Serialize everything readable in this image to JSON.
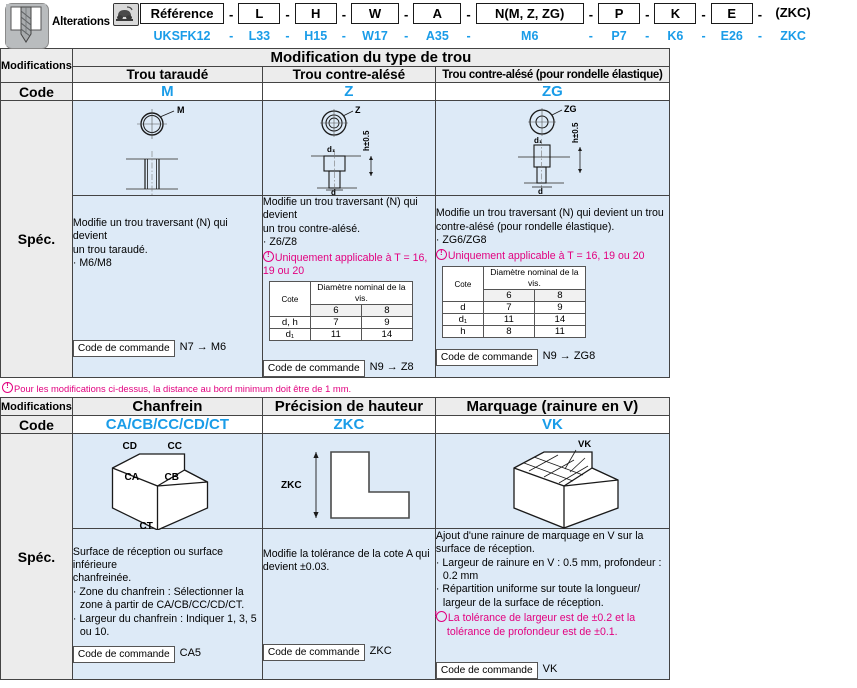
{
  "reference_strip": {
    "alterations_label": "Alterations",
    "product_icon": "drill-bit-icon",
    "phone_icon": "phone-icon",
    "fields": [
      {
        "label": "Référence",
        "value": "UKSFK12",
        "boxed": true
      },
      {
        "label": "L",
        "value": "L33",
        "boxed": true
      },
      {
        "label": "H",
        "value": "H15",
        "boxed": true
      },
      {
        "label": "W",
        "value": "W17",
        "boxed": true
      },
      {
        "label": "A",
        "value": "A35",
        "boxed": true
      },
      {
        "label": "N(M, Z, ZG)",
        "value": "M6",
        "boxed": true
      },
      {
        "label": "P",
        "value": "P7",
        "boxed": true
      },
      {
        "label": "K",
        "value": "K6",
        "boxed": true
      },
      {
        "label": "E",
        "value": "E26",
        "boxed": true
      },
      {
        "label": "(ZKC)",
        "value": "ZKC",
        "boxed": false
      }
    ],
    "separator": "-"
  },
  "section1": {
    "row_labels": {
      "modifications": "Modifications",
      "code": "Code",
      "spec": "Spéc."
    },
    "group_title": "Modification du type de trou",
    "columns": [
      {
        "header": "Trou taraudé",
        "code": "M",
        "figure_label": "M",
        "desc_lines": [
          "Modifie un trou traversant (N) qui devient",
          "un trou taraudé."
        ],
        "bullets": [
          "· M6/M8"
        ],
        "warning": null,
        "dim_table": null,
        "order_code_label": "Code de commande",
        "order_code_value": "N7 → M6"
      },
      {
        "header": "Trou contre-alésé",
        "code": "Z",
        "figure_label": "Z",
        "desc_lines": [
          "Modifie un trou traversant (N) qui devient",
          "un trou contre-alésé."
        ],
        "bullets": [
          "· Z6/Z8"
        ],
        "warning": "Uniquement applicable à T = 16, 19 ou 20",
        "dim_table": {
          "corner_label": "Cote",
          "span_header": "Diamètre nominal de la vis.",
          "sizes": [
            "6",
            "8"
          ],
          "rows": [
            {
              "label": "d, h",
              "values": [
                "7",
                "9"
              ]
            },
            {
              "label": "d₁",
              "values": [
                "11",
                "14"
              ]
            }
          ]
        },
        "order_code_label": "Code de commande",
        "order_code_value": "N9 → Z8"
      },
      {
        "header": "Trou contre-alésé (pour rondelle élastique)",
        "code": "ZG",
        "figure_label": "ZG",
        "desc_lines": [
          "Modifie un trou traversant (N) qui devient un trou",
          "contre-alésé (pour rondelle élastique)."
        ],
        "bullets": [
          "· ZG6/ZG8"
        ],
        "warning": "Uniquement applicable à T = 16, 19 ou 20",
        "dim_table": {
          "corner_label": "Cote",
          "span_header": "Diamètre nominal de la vis.",
          "sizes": [
            "6",
            "8"
          ],
          "rows": [
            {
              "label": "d",
              "values": [
                "7",
                "9"
              ]
            },
            {
              "label": "d₁",
              "values": [
                "11",
                "14"
              ]
            },
            {
              "label": "h",
              "values": [
                "8",
                "11"
              ]
            }
          ]
        },
        "order_code_label": "Code de commande",
        "order_code_value": "N9 → ZG8"
      }
    ],
    "figure_dims": {
      "d1": "d₁",
      "d": "d",
      "h_tol": "h±0.5"
    },
    "footnote": "Pour les modifications ci-dessus, la distance au bord minimum doit être de 1 mm."
  },
  "section2": {
    "row_labels": {
      "modifications": "Modifications",
      "code": "Code",
      "spec": "Spéc."
    },
    "columns": [
      {
        "header": "Chanfrein",
        "code": "CA/CB/CC/CD/CT",
        "figure_labels": [
          "CD",
          "CC",
          "CA",
          "CB",
          "CT"
        ],
        "desc_lines": [
          "Surface de réception ou surface inférieure",
          "chanfreinée."
        ],
        "bullets": [
          "· Zone du chanfrein : Sélectionner la zone à partir de CA/CB/CC/CD/CT.",
          "· Largeur du chanfrein : Indiquer 1, 3, 5 ou 10."
        ],
        "warning": null,
        "order_code_label": "Code de commande",
        "order_code_value": "CA5"
      },
      {
        "header": "Précision de hauteur",
        "code": "ZKC",
        "figure_labels": [
          "ZKC"
        ],
        "desc_lines": [
          "Modifie la tolérance de la cote A qui",
          "devient ±0.03."
        ],
        "bullets": [],
        "warning": null,
        "order_code_label": "Code de commande",
        "order_code_value": "ZKC"
      },
      {
        "header": "Marquage (rainure en V)",
        "code": "VK",
        "figure_labels": [
          "VK"
        ],
        "desc_lines": [
          "Ajout d'une rainure de marquage en V sur la",
          "surface de réception."
        ],
        "bullets": [
          "· Largeur de rainure en V : 0.5 mm, profondeur : 0.2 mm",
          "· Répartition uniforme sur toute la longueur/ largeur de la surface de réception."
        ],
        "warning": "La tolérance de largeur est de ±0.2 et la tolérance de profondeur est de ±0.1.",
        "order_code_label": "Code de commande",
        "order_code_value": "VK"
      }
    ]
  },
  "colors": {
    "accent_blue": "#1a9ce8",
    "warning_pink": "#e2007f",
    "fig_background": "#ddeaf7",
    "header_grey": "#ececec"
  }
}
